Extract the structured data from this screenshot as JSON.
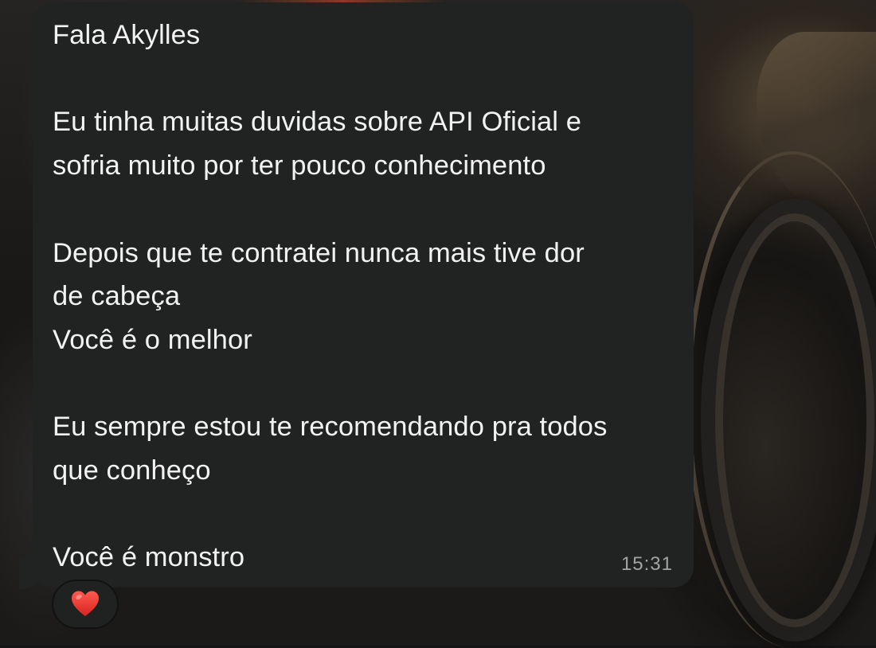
{
  "message": {
    "text": "Fala Akylles\n\nEu tinha muitas duvidas sobre API Oficial e\nsofria muito por ter pouco conhecimento\n\nDepois que te contratei nunca mais tive dor\nde cabeça\nVocê é o melhor\n\nEu sempre estou te recomendando pra todos\nque conheço\n\nVocê é monstro",
    "time": "15:31"
  },
  "reaction": {
    "icon": "red-heart-icon",
    "color": "#e5322d"
  },
  "colors": {
    "bubble": "#212222",
    "text": "#f2f2f2",
    "timestamp": "#a3a3a3"
  }
}
